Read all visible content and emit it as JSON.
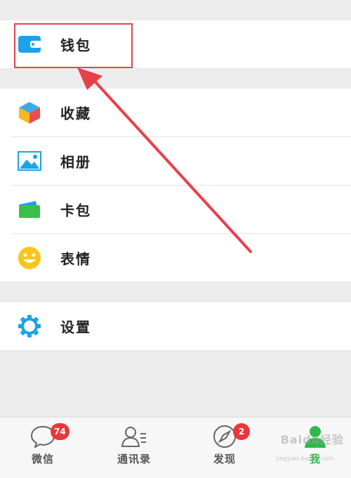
{
  "menu": {
    "wallet": "钱包",
    "favorites": "收藏",
    "album": "相册",
    "cards": "卡包",
    "stickers": "表情",
    "settings": "设置"
  },
  "icons": {
    "wallet": "wallet-icon",
    "favorites": "cube-icon",
    "album": "picture-icon",
    "cards": "card-icon",
    "stickers": "smiley-icon",
    "settings": "gear-icon"
  },
  "tabbar": {
    "chats": {
      "label": "微信",
      "badge": "74"
    },
    "contacts": {
      "label": "通讯录"
    },
    "discover": {
      "label": "发现",
      "badge": "2"
    },
    "me": {
      "label": "我"
    }
  },
  "watermark": {
    "text": "Baidu经验",
    "url": "jingyan.baidu.com"
  },
  "colors": {
    "accent": "#2fb84a",
    "badge": "#e8383d",
    "highlight": "#e0454e",
    "blue": "#1aa3ea"
  }
}
